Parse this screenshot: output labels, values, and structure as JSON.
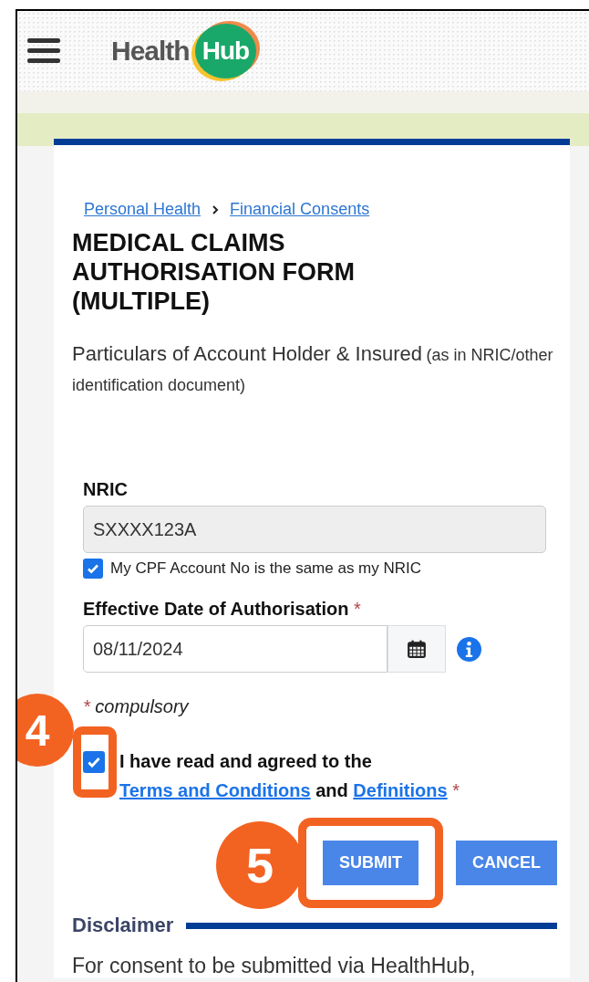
{
  "header": {
    "logo_text": "Health",
    "logo_badge": "Hub"
  },
  "breadcrumb": [
    {
      "label": "Personal Health"
    },
    {
      "label": "Financial Consents"
    }
  ],
  "title": "MEDICAL CLAIMS AUTHORISATION FORM (MULTIPLE)",
  "section": {
    "heading": "Particulars of Account Holder & Insured",
    "note": "(as in NRIC/other identification document)"
  },
  "nric": {
    "label": "NRIC",
    "value": "SXXXX123A",
    "disabled": true
  },
  "same_cpf": {
    "label": "My CPF Account No is the same as my NRIC",
    "checked": true
  },
  "effective_date": {
    "label": "Effective Date of Authorisation",
    "required_mark": "*",
    "value": "08/11/2024"
  },
  "compulsory": {
    "mark": "*",
    "text": "compulsory"
  },
  "agreement": {
    "checked": true,
    "before": "I have read and agreed to the",
    "link_1": "Terms and Conditions",
    "middle": "and",
    "link_2": "Definitions",
    "required_mark": "*"
  },
  "buttons": [
    {
      "label": "SUBMIT",
      "highlighted": true
    },
    {
      "label": "CANCEL",
      "highlighted": false
    }
  ],
  "disclaimer": {
    "heading": "Disclaimer",
    "text": "For consent to be submitted via HealthHub,"
  },
  "callouts": [
    {
      "number": "4"
    },
    {
      "number": "5"
    }
  ]
}
